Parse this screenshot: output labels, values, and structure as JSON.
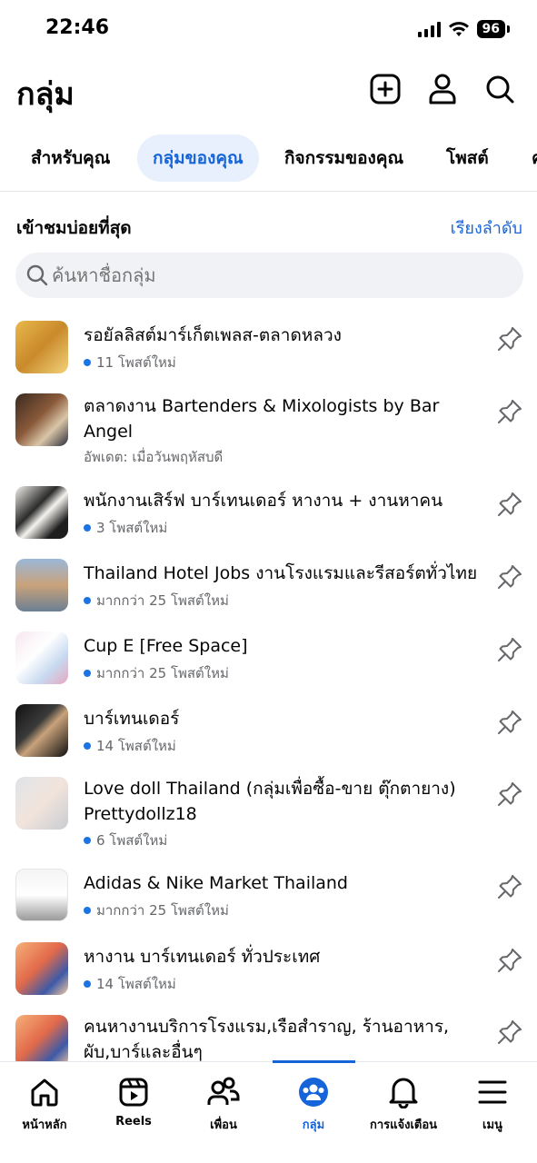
{
  "status": {
    "time": "22:46",
    "battery": "96"
  },
  "header": {
    "title": "กลุ่ม"
  },
  "tabs": [
    {
      "label": "สำหรับคุณ",
      "active": false
    },
    {
      "label": "กลุ่มของคุณ",
      "active": true
    },
    {
      "label": "กิจกรรมของคุณ",
      "active": false
    },
    {
      "label": "โพสต์",
      "active": false
    },
    {
      "label": "ค",
      "active": false
    }
  ],
  "section": {
    "title": "เข้าชมบ่อยที่สุด",
    "sort_label": "เรียงลำดับ"
  },
  "search": {
    "placeholder": "ค้นหาชื่อกลุ่ม"
  },
  "groups": [
    {
      "name": "รอยัลลิสต์มาร์เก็ตเพลส-ตลาดหลวง",
      "meta": "11 โพสต์ใหม่",
      "new_dot": true
    },
    {
      "name": "ตลาดงาน Bartenders & Mixologists by Bar Angel",
      "meta": "อัพเดต: เมื่อวันพฤหัสบดี",
      "new_dot": false
    },
    {
      "name": "พนักงานเสิร์ฟ บาร์เทนเดอร์ หางาน + งานหาคน",
      "meta": "3 โพสต์ใหม่",
      "new_dot": true
    },
    {
      "name": "Thailand Hotel Jobs งานโรงแรมและรีสอร์ตทั่วไทย",
      "meta": "มากกว่า 25 โพสต์ใหม่",
      "new_dot": true
    },
    {
      "name": "Cup E [Free Space]",
      "meta": "มากกว่า 25 โพสต์ใหม่",
      "new_dot": true
    },
    {
      "name": "บาร์เทนเดอร์",
      "meta": "14 โพสต์ใหม่",
      "new_dot": true
    },
    {
      "name": "Love doll Thailand (กลุ่มเพื่อซื้อ-ขาย ตุ๊กตายาง) Prettydollz18",
      "meta": "6 โพสต์ใหม่",
      "new_dot": true
    },
    {
      "name": "Adidas & Nike Market Thailand",
      "meta": "มากกว่า 25 โพสต์ใหม่",
      "new_dot": true
    },
    {
      "name": "หางาน บาร์เทนเดอร์ ทั่วประเทศ",
      "meta": "14 โพสต์ใหม่",
      "new_dot": true
    },
    {
      "name": "คนหางานบริการโรงแรม,เรือสำราญ, ร้านอาหาร, ผับ,บาร์และอื่นๆ",
      "meta": "",
      "new_dot": false
    }
  ],
  "nav": [
    {
      "label": "หน้าหลัก",
      "icon": "home-icon",
      "active": false
    },
    {
      "label": "Reels",
      "icon": "reels-icon",
      "active": false
    },
    {
      "label": "เพื่อน",
      "icon": "friends-icon",
      "active": false
    },
    {
      "label": "กลุ่ม",
      "icon": "groups-icon",
      "active": true
    },
    {
      "label": "การแจ้งเตือน",
      "icon": "bell-icon",
      "active": false
    },
    {
      "label": "เมนู",
      "icon": "menu-icon",
      "active": false
    }
  ],
  "colors": {
    "accent": "#1664d9",
    "active_tab_bg": "#e7f0fc",
    "dot": "#1b74e4",
    "search_bg": "#f0f2f5"
  }
}
